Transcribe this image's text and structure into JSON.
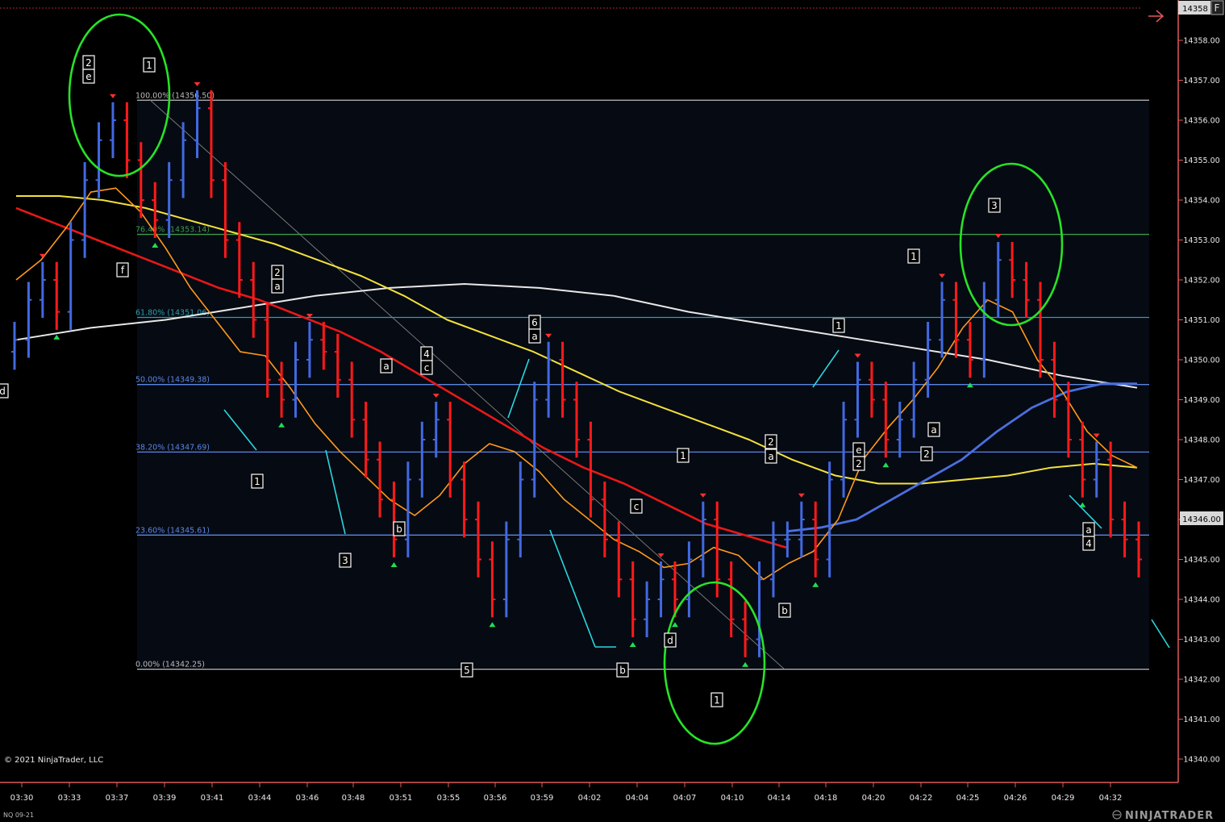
{
  "instrument": "NQ 09-21",
  "copyright": "© 2021 NinjaTrader, LLC",
  "brand": "NINJATRADER",
  "price_panel_label": "F",
  "current_price_label": "14358",
  "marker_price_label": "14346.00",
  "colors": {
    "background": "#000000",
    "up_bar": "#4169e1",
    "down_bar": "#ff1a1a",
    "fib_text": "#5b86e5",
    "ema_fast": "#ff9a1a",
    "ema_red": "#e81818",
    "ema_yellow": "#f2e23b",
    "sma_white": "#e8e8e8",
    "ema_blue": "#4a6fe0",
    "circle": "#27e327",
    "trend_line": "#2ad7e0",
    "axis": "#e05a5a"
  },
  "chart_data": {
    "type": "candlestick",
    "ylim": [
      14339.6,
      14359.2
    ],
    "y_ticks": [
      "14340.00",
      "14341.00",
      "14342.00",
      "14343.00",
      "14344.00",
      "14345.00",
      "14346.00",
      "14347.00",
      "14348.00",
      "14349.00",
      "14350.00",
      "14351.00",
      "14352.00",
      "14353.00",
      "14354.00",
      "14355.00",
      "14356.00",
      "14357.00",
      "14358.00"
    ],
    "x_ticks": [
      "03:30",
      "03:33",
      "03:37",
      "03:39",
      "03:41",
      "03:44",
      "03:46",
      "03:48",
      "03:51",
      "03:55",
      "03:56",
      "03:59",
      "04:02",
      "04:04",
      "04:07",
      "04:10",
      "04:14",
      "04:18",
      "04:20",
      "04:22",
      "04:25",
      "04:26",
      "04:29",
      "04:32"
    ],
    "fib_levels": [
      {
        "label": "100.00% (14356.50)",
        "price": 14356.5,
        "color": "#bbbbbb"
      },
      {
        "label": "76.40% (14353.14)",
        "price": 14353.14,
        "color": "#3d9b4a"
      },
      {
        "label": "61.80% (14351.06)",
        "price": 14351.06,
        "color": "#2e9fae"
      },
      {
        "label": "50.00% (14349.38)",
        "price": 14349.38,
        "color": "#5b86e5"
      },
      {
        "label": "38.20% (14347.69)",
        "price": 14347.69,
        "color": "#5b86e5"
      },
      {
        "label": "23.60% (14345.61)",
        "price": 14345.61,
        "color": "#5b86e5"
      },
      {
        "label": "0.00% (14342.25)",
        "price": 14342.25,
        "color": "#bbbbbb"
      }
    ],
    "series": [
      {
        "name": "price bars (approx. close)",
        "x_start": "03:30",
        "points": [
          14350.5,
          14351.5,
          14352.0,
          14351.2,
          14353.0,
          14354.5,
          14355.5,
          14356.0,
          14355.0,
          14354.0,
          14353.5,
          14354.5,
          14355.5,
          14356.3,
          14354.5,
          14353.0,
          14352.0,
          14351.0,
          14349.5,
          14349.0,
          14350.0,
          14350.5,
          14350.2,
          14349.5,
          14348.5,
          14347.5,
          14346.5,
          14345.5,
          14347.0,
          14348.0,
          14348.5,
          14347.0,
          14346.0,
          14345.0,
          14344.0,
          14345.5,
          14347.0,
          14349.0,
          14350.0,
          14349.0,
          14348.0,
          14346.5,
          14345.5,
          14344.5,
          14343.5,
          14344.0,
          14344.5,
          14344.0,
          14345.0,
          14346.0,
          14344.5,
          14343.5,
          14343.0,
          14344.5,
          14345.5,
          14345.5,
          14346.0,
          14345.0,
          14347.0,
          14348.5,
          14349.5,
          14349.0,
          14348.0,
          14348.5,
          14349.5,
          14350.5,
          14351.5,
          14350.5,
          14350.0,
          14351.5,
          14352.5,
          14352.0,
          14351.5,
          14350.0,
          14349.0,
          14348.0,
          14347.0,
          14347.5,
          14346.0,
          14345.5,
          14345.0
        ]
      }
    ],
    "ema_fast": [
      14352.0,
      14352.5,
      14353.3,
      14354.2,
      14354.3,
      14353.7,
      14352.8,
      14351.8,
      14351.0,
      14350.2,
      14350.1,
      14349.3,
      14348.4,
      14347.7,
      14347.1,
      14346.5,
      14346.1,
      14346.6,
      14347.4,
      14347.9,
      14347.7,
      14347.2,
      14346.5,
      14346.0,
      14345.5,
      14345.2,
      14344.8,
      14344.9,
      14345.3,
      14345.1,
      14344.5,
      14344.9,
      14345.2,
      14346.0,
      14347.5,
      14348.3,
      14349.0,
      14349.8,
      14350.8,
      14351.5,
      14351.2,
      14350.0,
      14349.2,
      14348.2,
      14347.6,
      14347.3
    ],
    "ema_red": [
      14353.8,
      14353.4,
      14353.0,
      14352.6,
      14352.2,
      14351.8,
      14351.5,
      14351.1,
      14350.7,
      14350.2,
      14349.6,
      14349.0,
      14348.4,
      14347.8,
      14347.3,
      14346.9,
      14346.4,
      14345.9,
      14345.6,
      14345.3
    ],
    "ema_yellow": [
      14354.1,
      14354.1,
      14354.0,
      14353.8,
      14353.5,
      14353.2,
      14352.9,
      14352.5,
      14352.1,
      14351.6,
      14351.0,
      14350.6,
      14350.2,
      14349.7,
      14349.2,
      14348.8,
      14348.4,
      14348.0,
      14347.5,
      14347.1,
      14346.9,
      14346.9,
      14347.0,
      14347.1,
      14347.3,
      14347.4,
      14347.3
    ],
    "sma_white": [
      14350.5,
      14350.8,
      14351.0,
      14351.3,
      14351.6,
      14351.8,
      14351.9,
      14351.8,
      14351.6,
      14351.2,
      14350.9,
      14350.6,
      14350.3,
      14350.0,
      14349.6,
      14349.3
    ],
    "ema_blue": [
      14345.7,
      14345.8,
      14346.0,
      14346.5,
      14347.0,
      14347.5,
      14348.2,
      14348.8,
      14349.2,
      14349.4,
      14349.4
    ],
    "wave_labels": [
      "2",
      "e",
      "1",
      "f",
      "2",
      "a",
      "1",
      "3",
      "b",
      "a",
      "4",
      "c",
      "5",
      "6",
      "a",
      "b",
      "c",
      "d",
      "1",
      "1",
      "2",
      "a",
      "b",
      "1",
      "e",
      "2",
      "1",
      "a",
      "2",
      "3",
      "a",
      "4",
      "d"
    ]
  }
}
